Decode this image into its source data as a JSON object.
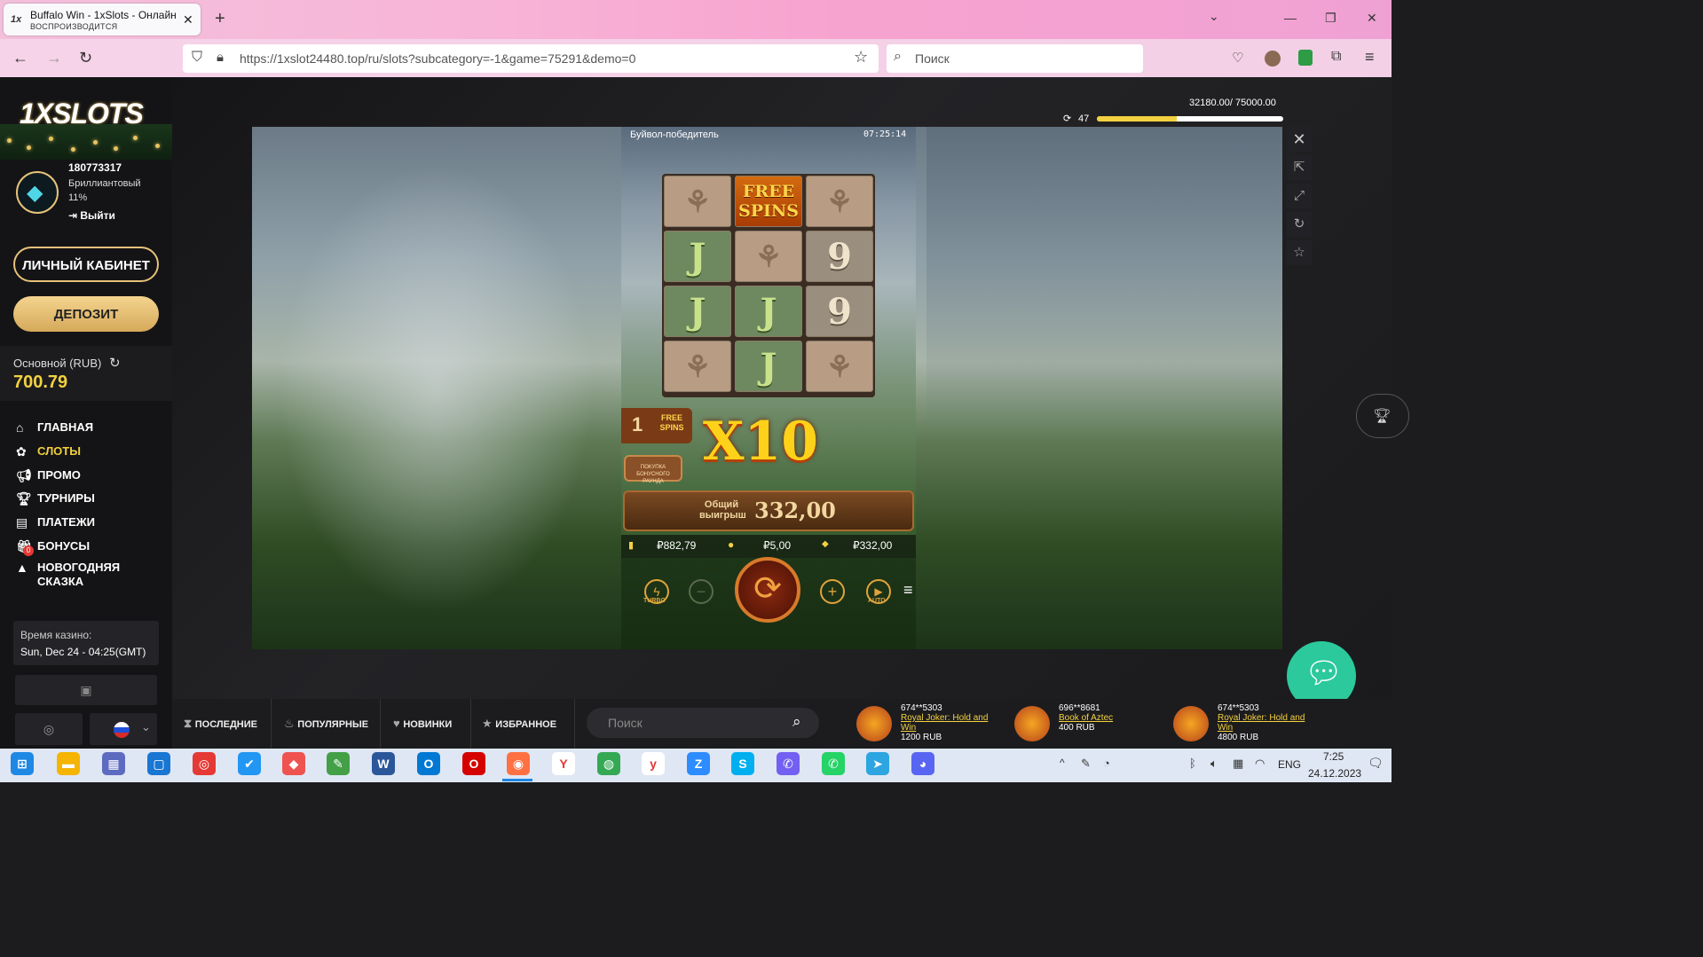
{
  "browser": {
    "tab_title": "Buffalo Win - 1xSlots - Онлайн",
    "tab_subtitle": "ВОСПРОИЗВОДИТСЯ",
    "url": "https://1xslot24480.top/ru/slots?subcategory=-1&game=75291&demo=0",
    "search_placeholder": "Поиск"
  },
  "sidebar": {
    "logo": "1XSLOTS",
    "user_id": "180773317",
    "level": "Бриллиантовый",
    "percent": "11%",
    "logout": "Выйти",
    "cabinet": "ЛИЧНЫЙ КАБИНЕТ",
    "deposit": "ДЕПОЗИТ",
    "balance_label": "Основной (RUB)",
    "balance": "700.79",
    "menu": [
      {
        "icon": "home-icon",
        "label": "ГЛАВНАЯ",
        "color": "#ffffff"
      },
      {
        "icon": "slots-icon",
        "label": "СЛОТЫ",
        "color": "#f3d13f"
      },
      {
        "icon": "promo-icon",
        "label": "ПРОМО",
        "color": "#ffffff"
      },
      {
        "icon": "trophy-icon",
        "label": "ТУРНИРЫ",
        "color": "#ffffff"
      },
      {
        "icon": "wallet-icon",
        "label": "ПЛАТЕЖИ",
        "color": "#ffffff"
      },
      {
        "icon": "gift-icon",
        "label": "БОНУСЫ",
        "color": "#ffffff"
      },
      {
        "icon": "tree-icon",
        "label": "НОВОГОДНЯЯ СКАЗКА",
        "color": "#ffffff"
      }
    ],
    "bonus_badge": "0",
    "casino_time_label": "Время казино:",
    "casino_time": "Sun, Dec 24 - 04:25(GMT)"
  },
  "progress": {
    "text": "32180.00/ 75000.00",
    "count": "47",
    "fraction": 0.429
  },
  "game": {
    "title": "Буйвол-победитель",
    "clock": "07:25:14",
    "grid": [
      [
        "wheat",
        "free",
        "wheat"
      ],
      [
        "J",
        "wheat",
        "9"
      ],
      [
        "J",
        "J",
        "9"
      ],
      [
        "wheat",
        "J",
        "wheat"
      ]
    ],
    "free_label": "FREE SPINS",
    "free_count": "1",
    "buy_bonus": "ПОКУПКА БОНУСНОГО РАУНДА",
    "multiplier": "X10",
    "total_win_label": "Общий выигрыш",
    "total_win": "332,00",
    "balance": "₽882,79",
    "bet": "₽5,00",
    "win": "₽332,00",
    "turbo": "TURBO",
    "auto": "AUTO"
  },
  "bottom": {
    "tabs": [
      "ПОСЛЕДНИЕ",
      "ПОПУЛЯРНЫЕ",
      "НОВИНКИ",
      "ИЗБРАННОЕ"
    ],
    "search_placeholder": "Поиск",
    "winners": [
      {
        "user": "674**5303",
        "game": "Royal Joker: Hold and Win",
        "amount": "1200 RUB"
      },
      {
        "user": "696**8681",
        "game": "Book of Aztec",
        "amount": "400 RUB"
      },
      {
        "user": "674**5303",
        "game": "Royal Joker: Hold and Win",
        "amount": "4800 RUB"
      }
    ]
  },
  "taskbar": {
    "lang": "ENG",
    "time": "7:25",
    "date": "24.12.2023"
  }
}
